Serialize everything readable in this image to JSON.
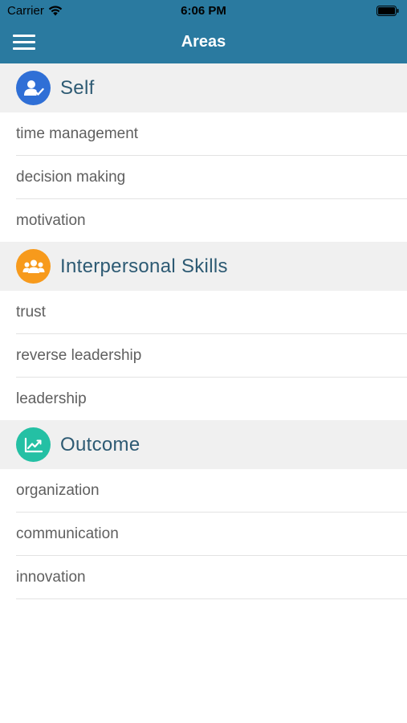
{
  "status_bar": {
    "carrier": "Carrier",
    "time": "6:06 PM"
  },
  "nav": {
    "title": "Areas",
    "menu_icon": "hamburger-menu-icon"
  },
  "colors": {
    "nav_bar": "#2a7aa0",
    "header_bg": "#f0f0f0",
    "header_text": "#2d5a73",
    "self_icon": "#2f6fd6",
    "interpersonal_icon": "#f79a1c",
    "outcome_icon": "#24c0a4"
  },
  "sections": [
    {
      "title": "Self",
      "icon": "user-check-icon",
      "items": [
        {
          "label": "time management"
        },
        {
          "label": "decision making"
        },
        {
          "label": "motivation"
        }
      ]
    },
    {
      "title": "Interpersonal Skills",
      "icon": "group-icon",
      "items": [
        {
          "label": "trust"
        },
        {
          "label": "reverse leadership"
        },
        {
          "label": "leadership"
        }
      ]
    },
    {
      "title": "Outcome",
      "icon": "chart-line-icon",
      "items": [
        {
          "label": "organization"
        },
        {
          "label": "communication"
        },
        {
          "label": "innovation"
        }
      ]
    }
  ]
}
